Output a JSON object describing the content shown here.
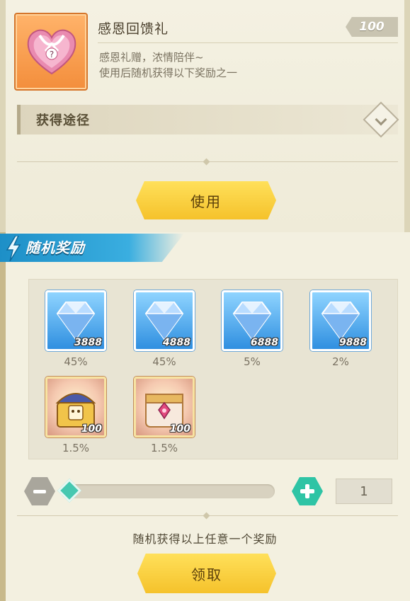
{
  "item": {
    "name": "感恩回馈礼",
    "count": "100",
    "desc_line1": "感恩礼赠，浓情陪伴~",
    "desc_line2": "使用后随机获得以下奖励之一",
    "icon": "heart-gift-box-icon"
  },
  "source": {
    "label": "获得途径"
  },
  "use_button": {
    "label": "使用"
  },
  "rewards_section": {
    "title": "随机奖励",
    "items": [
      {
        "type": "diamond",
        "qty": "3888",
        "chance": "45%"
      },
      {
        "type": "diamond",
        "qty": "4888",
        "chance": "45%"
      },
      {
        "type": "diamond",
        "qty": "6888",
        "chance": "5%"
      },
      {
        "type": "diamond",
        "qty": "9888",
        "chance": "2%"
      },
      {
        "type": "gold-chest",
        "qty": "100",
        "chance": "1.5%"
      },
      {
        "type": "pink-chest",
        "qty": "100",
        "chance": "1.5%"
      }
    ]
  },
  "quantity": {
    "value": "1",
    "min": 1,
    "max": 100
  },
  "footer_note": "随机获得以上任意一个奖励",
  "claim_button": {
    "label": "领取"
  },
  "colors": {
    "accent_yellow": "#f5c22b",
    "accent_teal": "#2ec4a5",
    "header_blue": "#1d8fc7"
  }
}
